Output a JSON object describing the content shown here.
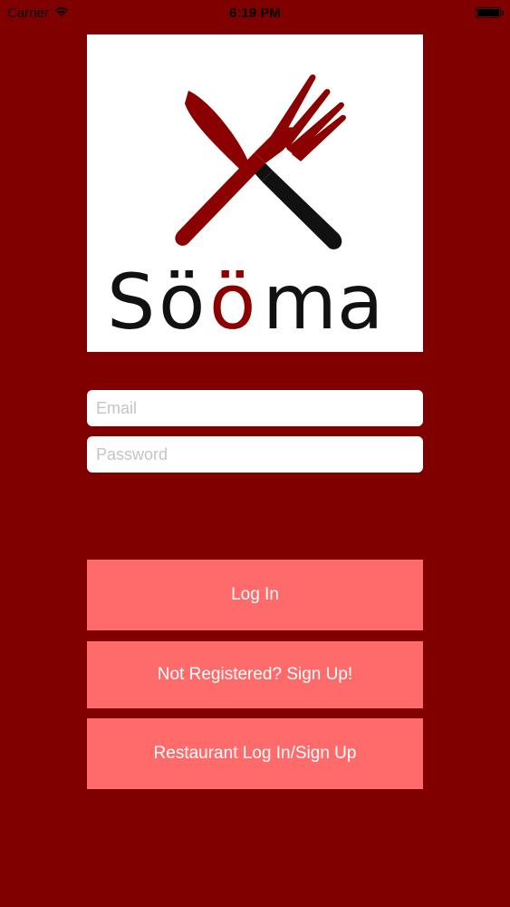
{
  "status_bar": {
    "carrier": "Carrier",
    "time": "6:19 PM",
    "wifi_icon": "wifi-icon",
    "battery_icon": "battery-icon",
    "battery_level": 1.0
  },
  "logo": {
    "brand_name_prefix": "S",
    "brand_name_o1": "ö",
    "brand_name_o2": "ö",
    "brand_name_suffix": "ma",
    "icon": "fork-and-knife-icon",
    "brand_dark_color": "#111111",
    "brand_red_color": "#8b0000"
  },
  "form": {
    "email_placeholder": "Email",
    "email_value": "",
    "password_placeholder": "Password",
    "password_value": ""
  },
  "buttons": {
    "login_label": "Log In",
    "signup_label": "Not Registered? Sign Up!",
    "restaurant_label": "Restaurant Log In/Sign Up"
  },
  "colors": {
    "background": "#800000",
    "button": "#ff6b6b",
    "button_text": "#ffffff"
  }
}
